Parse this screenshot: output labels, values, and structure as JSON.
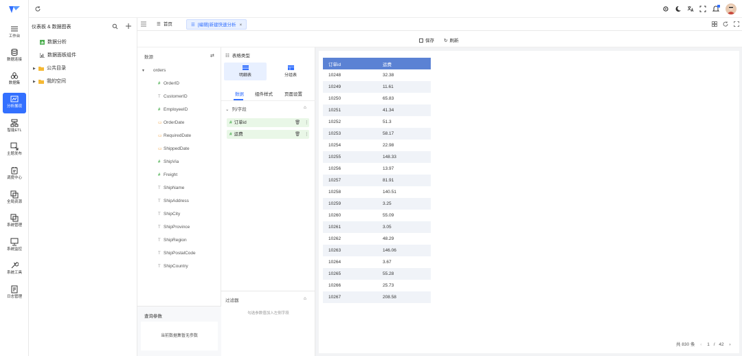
{
  "sidebar": {
    "items": [
      {
        "label": "工作台",
        "icon": "menu-icon"
      },
      {
        "label": "数据连接",
        "icon": "database-icon"
      },
      {
        "label": "数据集",
        "icon": "dataset-icon"
      },
      {
        "label": "分析展现",
        "icon": "chart-icon",
        "active": true
      },
      {
        "label": "智能ETL",
        "icon": "etl-icon"
      },
      {
        "label": "主题发布",
        "icon": "publish-icon"
      },
      {
        "label": "调度中心",
        "icon": "schedule-icon"
      },
      {
        "label": "全局资源",
        "icon": "resource-icon"
      },
      {
        "label": "系统管理",
        "icon": "system-icon"
      },
      {
        "label": "系统监控",
        "icon": "monitor-icon"
      },
      {
        "label": "系统工具",
        "icon": "tools-icon"
      },
      {
        "label": "日志管理",
        "icon": "log-icon"
      }
    ]
  },
  "tree": {
    "header": "仪表板 & 数据图表",
    "items": [
      {
        "label": "数据分析",
        "type": "chart"
      },
      {
        "label": "数据面板组件",
        "type": "component"
      },
      {
        "label": "公共目录",
        "type": "folder"
      },
      {
        "label": "我的空间",
        "type": "folder"
      }
    ]
  },
  "tabs": {
    "home": "首页",
    "active": "[编辑]新建快速分析",
    "close": "×"
  },
  "actions": {
    "save": "保存",
    "refresh": "刷新"
  },
  "source": {
    "title": "数源",
    "table": "orders",
    "fields": [
      {
        "name": "OrderID",
        "type": "number"
      },
      {
        "name": "CustomerID",
        "type": "text"
      },
      {
        "name": "EmployeeID",
        "type": "number"
      },
      {
        "name": "OrderDate",
        "type": "date"
      },
      {
        "name": "RequiredDate",
        "type": "date"
      },
      {
        "name": "ShippedDate",
        "type": "date"
      },
      {
        "name": "ShipVia",
        "type": "number"
      },
      {
        "name": "Freight",
        "type": "number"
      },
      {
        "name": "ShipName",
        "type": "text"
      },
      {
        "name": "ShipAddress",
        "type": "text"
      },
      {
        "name": "ShipCity",
        "type": "text"
      },
      {
        "name": "ShipProvince",
        "type": "text"
      },
      {
        "name": "ShipRegion",
        "type": "text"
      },
      {
        "name": "ShipPostalCode",
        "type": "text"
      },
      {
        "name": "ShipCountry",
        "type": "text"
      }
    ],
    "params_title": "查询参数",
    "params_empty": "当前数据集暂无参数"
  },
  "config": {
    "chart_type_title": "表格类型",
    "chart_types": [
      "明细表",
      "分组表"
    ],
    "tabs": [
      "数据",
      "组件样式",
      "页面设置"
    ],
    "columns_title": "列/字段",
    "chips": [
      "订单id",
      "运费"
    ],
    "filter_title": "过滤器",
    "filter_hint": "勾选参数值加入左侧字段"
  },
  "table": {
    "headers": [
      "订单id",
      "运费"
    ],
    "rows": [
      [
        "10248",
        "32.38"
      ],
      [
        "10249",
        "11.61"
      ],
      [
        "10250",
        "65.83"
      ],
      [
        "10251",
        "41.34"
      ],
      [
        "10252",
        "51.3"
      ],
      [
        "10253",
        "58.17"
      ],
      [
        "10254",
        "22.98"
      ],
      [
        "10255",
        "148.33"
      ],
      [
        "10256",
        "13.97"
      ],
      [
        "10257",
        "81.91"
      ],
      [
        "10258",
        "140.51"
      ],
      [
        "10259",
        "3.25"
      ],
      [
        "10260",
        "55.09"
      ],
      [
        "10261",
        "3.05"
      ],
      [
        "10262",
        "48.29"
      ],
      [
        "10263",
        "146.06"
      ],
      [
        "10264",
        "3.67"
      ],
      [
        "10265",
        "55.28"
      ],
      [
        "10266",
        "25.73"
      ],
      [
        "10267",
        "208.58"
      ]
    ]
  },
  "pagination": {
    "total": "共 830 条",
    "page": "1",
    "sep": "/",
    "pages": "42"
  },
  "colors": {
    "accent": "#3370ff",
    "header": "#5b82d4",
    "chip": "#e9f7e7",
    "canvas": "#f2f3f5"
  }
}
